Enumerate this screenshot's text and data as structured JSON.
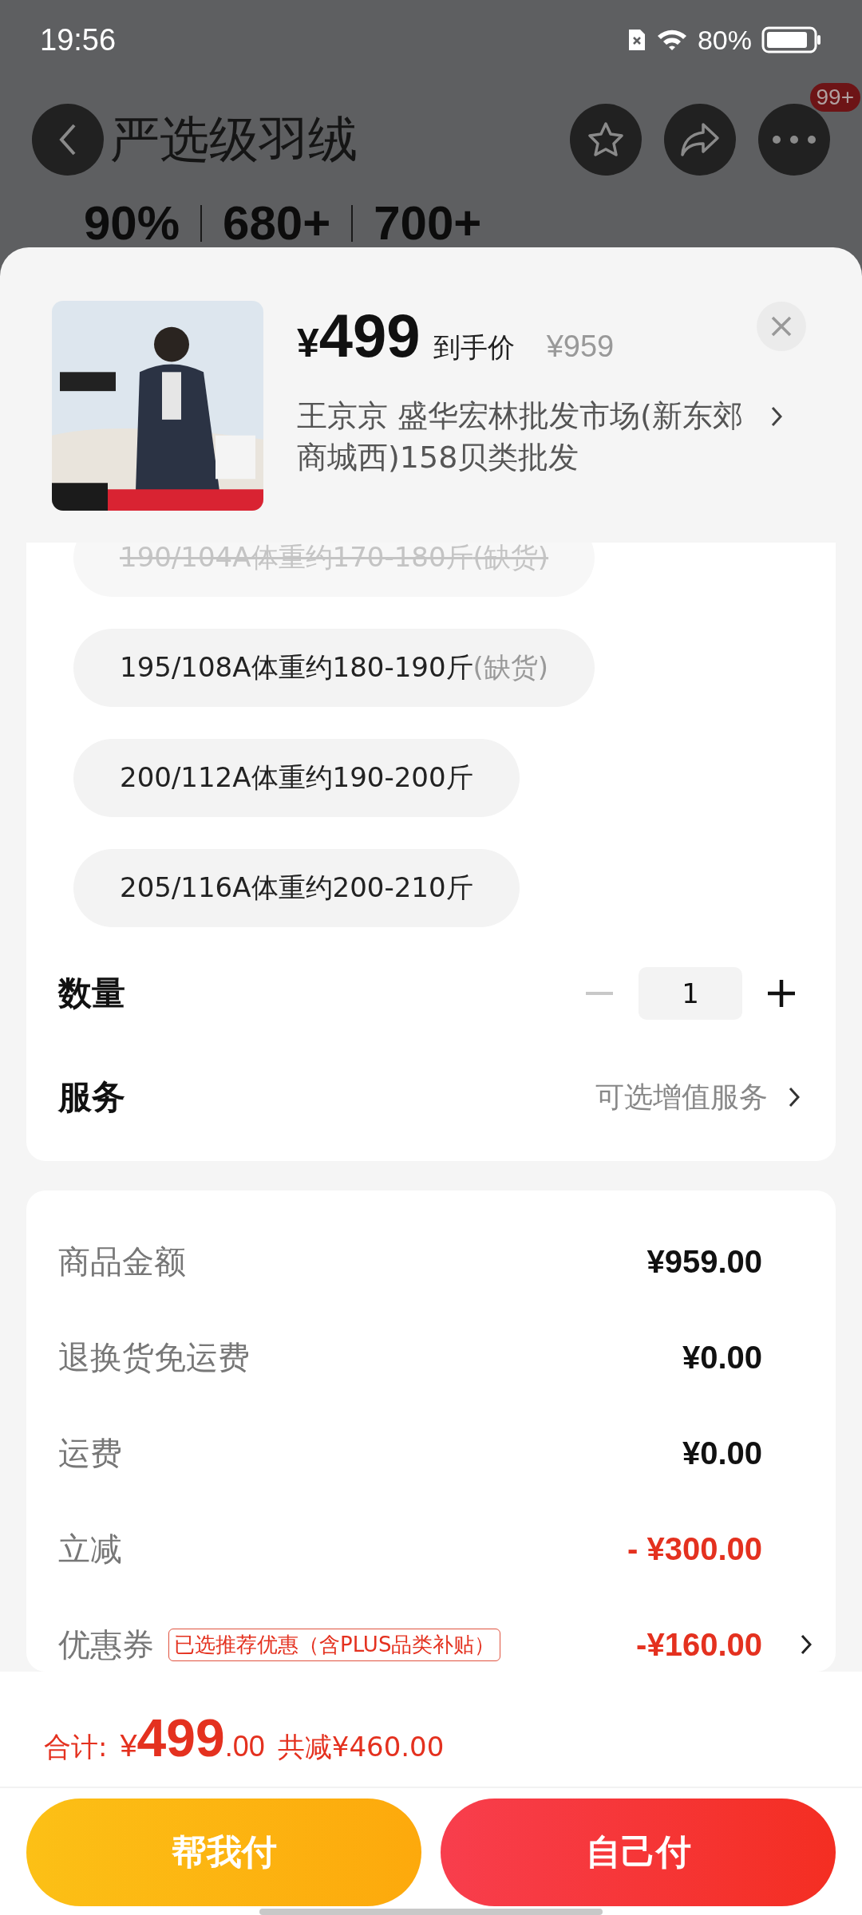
{
  "status_bar": {
    "time": "19:56",
    "battery": "80%"
  },
  "header": {
    "title": "严选级羽绒",
    "badge": "99+",
    "stats": [
      "90%",
      "680+",
      "700+"
    ]
  },
  "product": {
    "currency": "¥",
    "price": "499",
    "price_label": "到手价",
    "original_price": "¥959",
    "store": "王京京  盛华宏林批发市场(新东郊商城西)158贝类批发"
  },
  "sizes": [
    {
      "label": "190/104A体重约170-180斤",
      "note": "(缺货)",
      "disabled": true
    },
    {
      "label": "195/108A体重约180-190斤",
      "note": "(缺货)",
      "disabled": false
    },
    {
      "label": "200/112A体重约190-200斤",
      "disabled": false
    },
    {
      "label": "205/116A体重约200-210斤",
      "disabled": false
    }
  ],
  "quantity": {
    "label": "数量",
    "value": "1",
    "minus_disabled": true
  },
  "service": {
    "label": "服务",
    "value": "可选增值服务"
  },
  "summary": [
    {
      "kind": "amount",
      "label": "商品金额",
      "value": "¥959.00",
      "discount": false
    },
    {
      "kind": "amount",
      "label": "退换货免运费",
      "value": "¥0.00",
      "discount": false
    },
    {
      "kind": "amount",
      "label": "运费",
      "value": "¥0.00",
      "discount": false
    },
    {
      "kind": "amount",
      "label": "立减",
      "value": "- ¥300.00",
      "discount": true
    },
    {
      "kind": "coupon",
      "label": "优惠券",
      "tag": "已选推荐优惠（含PLUS品类补贴）",
      "value": "-¥160.00",
      "discount": true
    }
  ],
  "total": {
    "label": "合计:",
    "currency": "¥",
    "integer": "499",
    "decimals": ".00",
    "savings": "共减¥460.00"
  },
  "buttons": [
    {
      "label": "帮我付",
      "kind": "secondary"
    },
    {
      "label": "自己付",
      "kind": "primary"
    }
  ]
}
